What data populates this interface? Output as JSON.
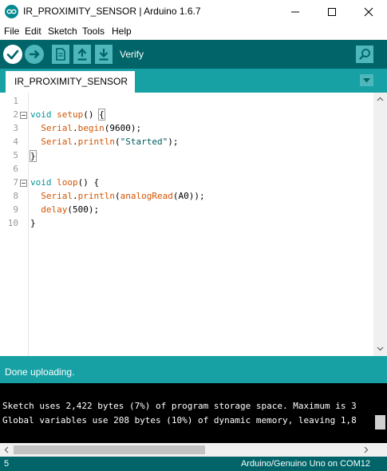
{
  "window": {
    "title": "IR_PROXIMITY_SENSOR | Arduino 1.6.7"
  },
  "menu": {
    "items": [
      "File",
      "Edit",
      "Sketch",
      "Tools",
      "Help"
    ]
  },
  "toolbar": {
    "status_label": "Verify"
  },
  "tabs": {
    "active": "IR_PROXIMITY_SENSOR"
  },
  "editor": {
    "line_numbers": [
      "1",
      "2",
      "3",
      "4",
      "5",
      "6",
      "7",
      "8",
      "9",
      "10"
    ],
    "code": [
      "",
      "void setup() {",
      "  Serial.begin(9600);",
      "  Serial.println(\"Started\");",
      "}",
      "",
      "void loop() {",
      "  Serial.println(analogRead(A0));",
      "  delay(500);",
      "}"
    ]
  },
  "status": {
    "message": "Done uploading."
  },
  "console": {
    "lines": [
      "Sketch uses 2,422 bytes (7%) of program storage space. Maximum is 3",
      "Global variables use 208 bytes (10%) of dynamic memory, leaving 1,8"
    ]
  },
  "footer": {
    "line_number": "5",
    "board": "Arduino/Genuino Uno on COM12"
  },
  "colors": {
    "toolbar": "#006468",
    "tabbar": "#17a1a5",
    "button": "#4db7bb",
    "keyword": "#00979c",
    "function": "#d35400"
  },
  "icons": {
    "app": "arduino-logo-icon",
    "verify": "checkmark-icon",
    "upload": "arrow-right-icon",
    "new": "new-file-icon",
    "open": "open-arrow-up-icon",
    "save": "save-arrow-down-icon",
    "serial_monitor": "magnifier-icon",
    "tab_menu": "chevron-down-icon"
  }
}
